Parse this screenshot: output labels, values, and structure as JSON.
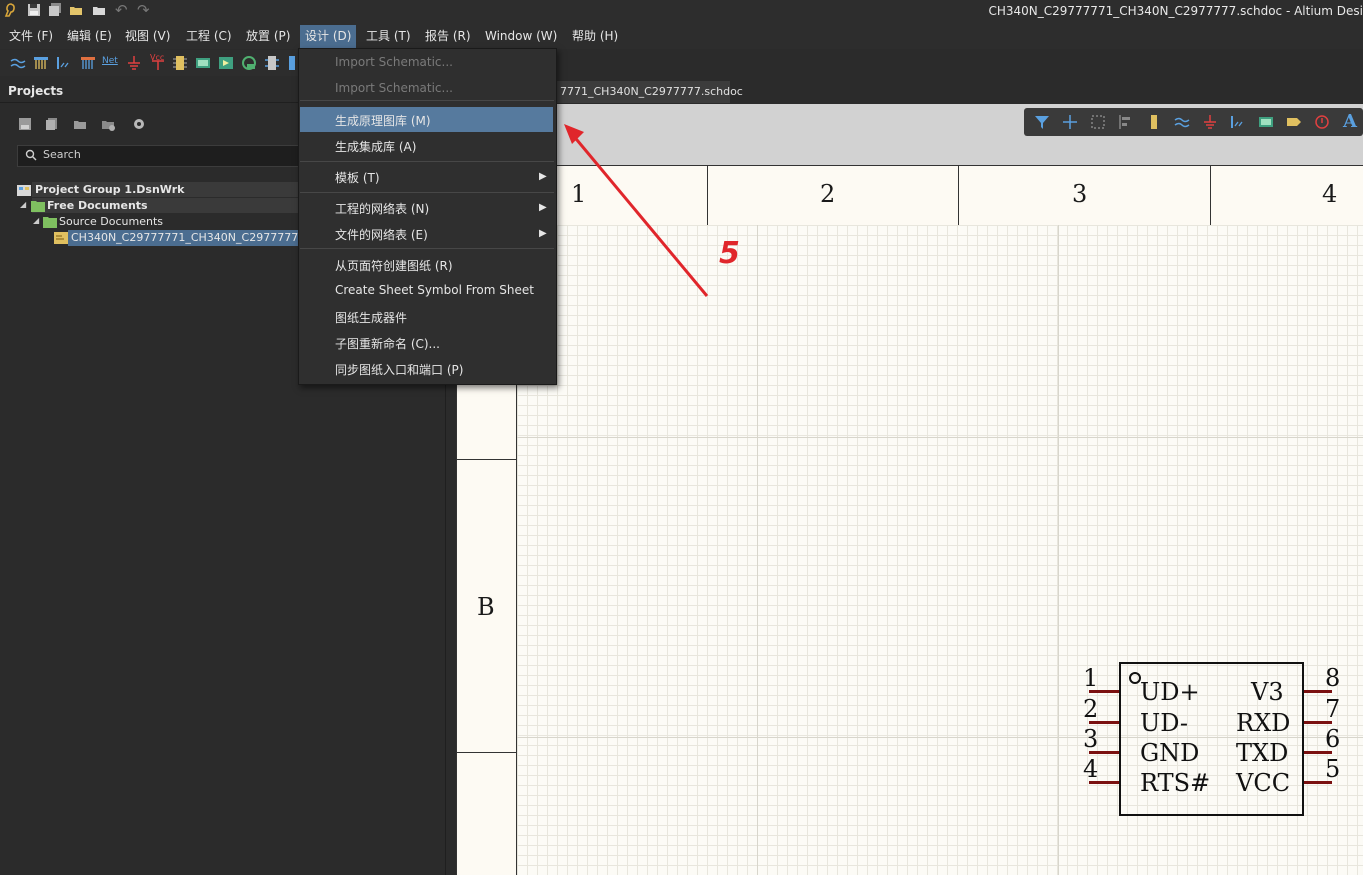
{
  "window": {
    "title": "CH340N_C29777771_CH340N_C2977777.schdoc - Altium Desi"
  },
  "menubar": [
    {
      "label": "文件 (F)"
    },
    {
      "label": "编辑 (E)"
    },
    {
      "label": "视图 (V)"
    },
    {
      "label": "工程 (C)"
    },
    {
      "label": "放置 (P)"
    },
    {
      "label": "设计 (D)"
    },
    {
      "label": "工具 (T)"
    },
    {
      "label": "报告 (R)"
    },
    {
      "label": "Window (W)"
    },
    {
      "label": "帮助 (H)"
    }
  ],
  "toolbar": {
    "net_label": "Net",
    "vcc_label": "Vcc"
  },
  "projects": {
    "title": "Projects",
    "search_placeholder": "Search",
    "tree": {
      "group": "Project Group 1.DsnWrk",
      "free_docs": "Free Documents",
      "source_docs": "Source Documents",
      "file": "CH340N_C29777771_CH340N_C2977777.schdo"
    }
  },
  "tab": {
    "label": "7771_CH340N_C2977777.schdoc"
  },
  "dropdown": {
    "items": [
      {
        "label": "Import Schematic...",
        "disabled": true
      },
      {
        "label": "Import Schematic...",
        "disabled": true
      },
      {
        "label": "生成原理图库 (M)",
        "highlight": true
      },
      {
        "label": "生成集成库 (A)"
      },
      {
        "label": "模板 (T)",
        "submenu": true
      },
      {
        "label": "工程的网络表 (N)",
        "submenu": true
      },
      {
        "label": "文件的网络表 (E)",
        "submenu": true
      },
      {
        "label": "从页面符创建图纸 (R)"
      },
      {
        "label": "Create Sheet Symbol From Sheet"
      },
      {
        "label": "图纸生成器件"
      },
      {
        "label": "子图重新命名 (C)..."
      },
      {
        "label": "同步图纸入口和端口 (P)"
      }
    ]
  },
  "sheet": {
    "zones_top": [
      "1",
      "2",
      "3",
      "4"
    ],
    "zone_left": "B"
  },
  "annotation": {
    "step": "5",
    "color": "#e0262b"
  },
  "component": {
    "left_pins": [
      {
        "num": "1",
        "name": "UD+"
      },
      {
        "num": "2",
        "name": "UD-"
      },
      {
        "num": "3",
        "name": "GND"
      },
      {
        "num": "4",
        "name": "RTS#"
      }
    ],
    "right_pins": [
      {
        "num": "8",
        "name": "V3"
      },
      {
        "num": "7",
        "name": "RXD"
      },
      {
        "num": "6",
        "name": "TXD"
      },
      {
        "num": "5",
        "name": "VCC"
      }
    ]
  },
  "colors": {
    "accent": "#4b6d90",
    "highlight": "#567a9e",
    "pin": "#7a1010"
  }
}
